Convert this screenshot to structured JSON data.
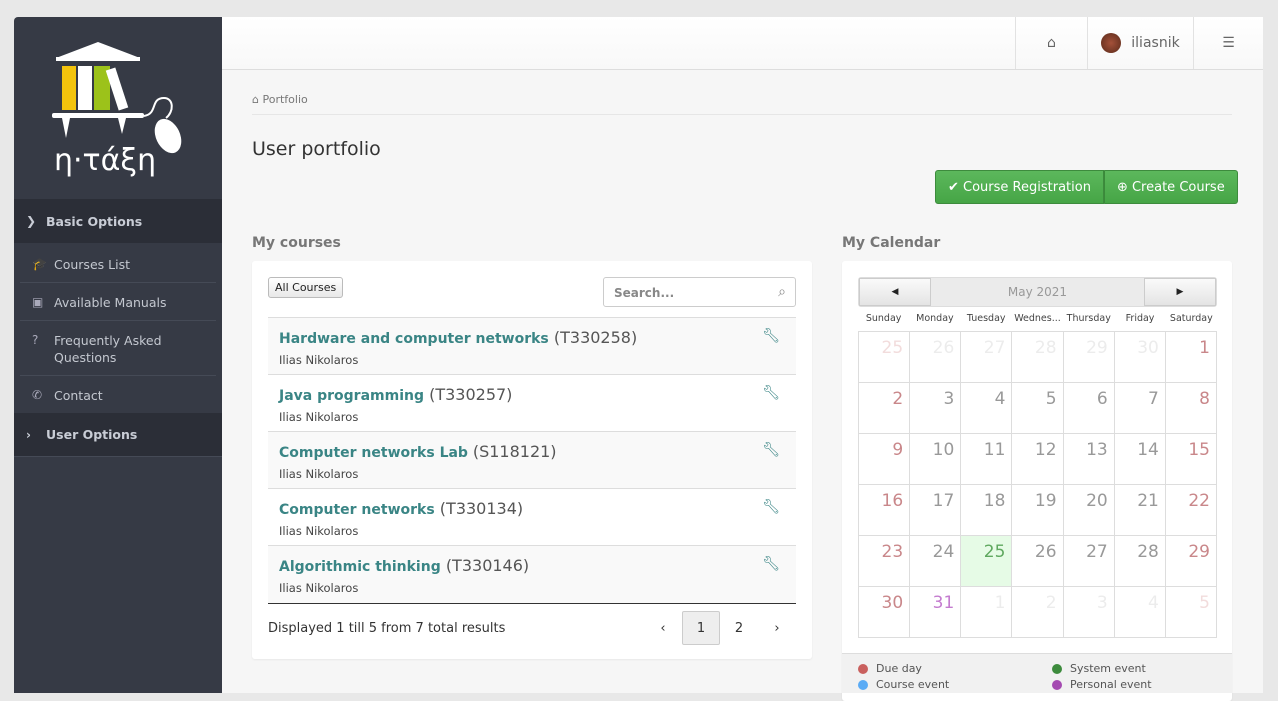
{
  "sidebar": {
    "logo_text": "η·τάξη",
    "sections": [
      {
        "label": "Basic Options",
        "expanded": true
      },
      {
        "label": "User Options",
        "expanded": false
      }
    ],
    "items": [
      {
        "label": "Courses List",
        "icon": "graduation-cap-icon"
      },
      {
        "label": "Available Manuals",
        "icon": "file-video-icon"
      },
      {
        "label": "Frequently Asked Questions",
        "icon": "question-circle-icon"
      },
      {
        "label": "Contact",
        "icon": "phone-icon"
      }
    ]
  },
  "header": {
    "username": "iliasnik"
  },
  "breadcrumb": "Portfolio",
  "page_title": "User portfolio",
  "actions": {
    "register": "Course Registration",
    "create": "Create Course"
  },
  "courses": {
    "title": "My courses",
    "filter": "All Courses",
    "search_placeholder": "Search...",
    "rows": [
      {
        "name": "Hardware and computer networks",
        "code": "(T330258)",
        "prof": "Ilias Nikolaros"
      },
      {
        "name": "Java programming",
        "code": "(T330257)",
        "prof": "Ilias Nikolaros"
      },
      {
        "name": "Computer networks Lab ",
        "code": "(S118121)",
        "prof": "Ilias Nikolaros"
      },
      {
        "name": "Computer networks",
        "code": "(T330134)",
        "prof": "Ilias Nikolaros"
      },
      {
        "name": "Algorithmic thinking",
        "code": "(T330146)",
        "prof": "Ilias Nikolaros"
      }
    ],
    "footer": "Displayed 1 till 5 from 7 total results",
    "pages": [
      "‹",
      "1",
      "2",
      "›"
    ],
    "current_page": "1"
  },
  "calendar": {
    "title": "My Calendar",
    "month": "May 2021",
    "days": [
      "Sunday",
      "Monday",
      "Tuesday",
      "Wednes...",
      "Thursday",
      "Friday",
      "Saturday"
    ],
    "cells": [
      "25",
      "26",
      "27",
      "28",
      "29",
      "30",
      "1",
      "2",
      "3",
      "4",
      "5",
      "6",
      "7",
      "8",
      "9",
      "10",
      "11",
      "12",
      "13",
      "14",
      "15",
      "16",
      "17",
      "18",
      "19",
      "20",
      "21",
      "22",
      "23",
      "24",
      "25",
      "26",
      "27",
      "28",
      "29",
      "30",
      "31",
      "1",
      "2",
      "3",
      "4",
      "5"
    ],
    "today_index": 30,
    "outside_indices": [
      0,
      1,
      2,
      3,
      4,
      5,
      37,
      38,
      39,
      40,
      41
    ],
    "personal_event_indices": [
      36
    ],
    "legend": [
      {
        "label": "Due day",
        "color": "#c9605e"
      },
      {
        "label": "System event",
        "color": "#3d8b3d"
      },
      {
        "label": "Course event",
        "color": "#5aabf5"
      },
      {
        "label": "Personal event",
        "color": "#a44ab1"
      }
    ]
  }
}
